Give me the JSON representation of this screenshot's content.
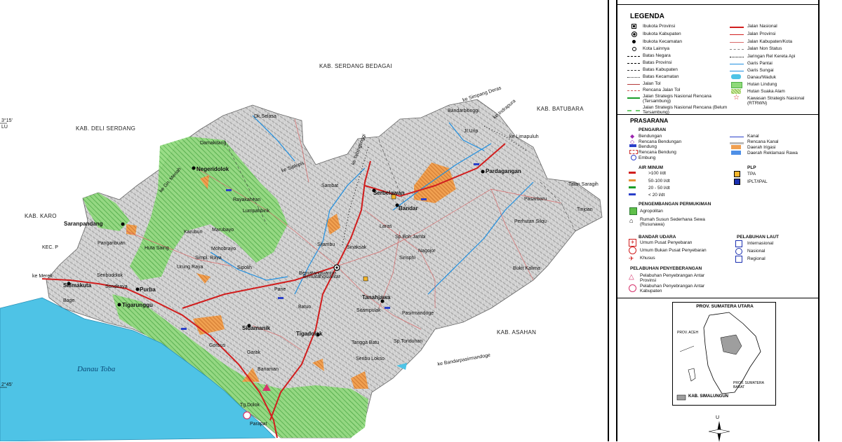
{
  "map": {
    "regions": {
      "deli_serdang": "KAB. DELI SERDANG",
      "serdang_bedagai": "KAB. SERDANG BEDAGAI",
      "batubara": "KAB. BATUBARA",
      "karo": "KAB. KARO",
      "asahan": "KAB. ASAHAN",
      "kec_karo": "KEC. P",
      "danau_toba": "Danau Toba"
    },
    "coords": {
      "lat_top": "3°15'",
      "lat_top_unit": "LU",
      "lat_bottom": "2°45'"
    },
    "towns": [
      "Dk.Selasa",
      "Damakitang",
      "Negeridolok",
      "Rayakahean",
      "Lumpahbirik",
      "Saranpandang",
      "Pangaribuan",
      "Huta Saing",
      "Karubun",
      "Marubayo",
      "Mohobrayo",
      "Simpl. Raya",
      "Urung Raya",
      "Sipolih",
      "Seribudolok",
      "Silimakuta",
      "Sondiraya",
      "Purba",
      "Tigarunggu",
      "Bage",
      "Sidamanik",
      "Gorbus",
      "Garak",
      "Banaman",
      "Tg.Dolok",
      "Parapat",
      "Tigadolok",
      "Batuo",
      "Bematangsiantar",
      "Pane",
      "Sitampulak",
      "Tanahjawa",
      "Pasirmandoge",
      "Tangga Batu",
      "Sp.Tonduhan",
      "Seribu Lokso",
      "Sijambu",
      "Sinaksak",
      "Laras",
      "Sp.Boh Jambi",
      "Sinsphi",
      "Nagojor",
      "Serbelawan",
      "Bandar",
      "Sambat",
      "Bandarbitinggi",
      "Jt.Urip",
      "Pardagangan",
      "Pasarbaru",
      "Perhutan Silqu",
      "Bukit Kalima",
      "Talan Saragih",
      "Tinjoan"
    ],
    "road_labels": {
      "to_merak": "ke Merek",
      "to_simpang_deras": "ke Simpang Deras",
      "to_indrapura": "ke Indrapura",
      "to_limapuluh": "ke Limapuluh",
      "to_tebingtinggi": "ke Tebingtinggi",
      "to_siplepis": "ke Siplepis",
      "to_gn_meriah": "ke Gn. Meriah",
      "to_bandarpasirmandoge": "ke Bandarpasirmandoge"
    }
  },
  "legend": {
    "title": "LEGENDA",
    "col1": [
      "Ibukota Provinsi",
      "Ibukota Kabupaten",
      "Ibukota Kecamatan",
      "Kota Lainnya",
      "Batas Negara",
      "Batas Provinsi",
      "Batas Kabupaten",
      "Batas Kecamatan",
      "Jalan Tol",
      "Rencana Jalan Tol",
      "Jalan Strategis Nasional Rencana (Tersambung)",
      "Jalan Strategis Nasional Rencana (Belum Tersambung)"
    ],
    "col2": [
      "Jalan Nasional",
      "Jalan Provinsi",
      "Jalan Kabupaten/Kota",
      "Jalan Non Status",
      "Jaringan Rel Kereta Api",
      "Garis Pantai",
      "Garis Sungai",
      "Danau/Waduk",
      "Hutan Lindung",
      "Hutan Suaka Alam",
      "Kawasan Strategis Nasional (RTRWN)"
    ],
    "prasarana_title": "PRASARANA",
    "pengairan_title": "PENGAIRAN",
    "pengairan": [
      "Bendungan",
      "Rencana Bendungan",
      "Bendung",
      "Rencana Bendung",
      "Embung"
    ],
    "pengairan_right": [
      "Kanal",
      "Rencana Kanal",
      "Daerah Irigasi",
      "Daerah Reklamasi Rawa"
    ],
    "air_minum_title": "AIR MINUM",
    "air_minum": [
      ">100 l/dt",
      "50-100 l/dt",
      "20 - 50 l/dt",
      "< 20 l/dt"
    ],
    "plp_title": "PLP",
    "plp": [
      "TPA",
      "IPLT/IPAL"
    ],
    "permukiman_title": "PENGEMBANGAN PERMUKIMAN",
    "permukiman": [
      "Agropolitan",
      "Rumah Susun Sederhana Sewa (Rusunawa)"
    ],
    "bandara_title": "BANDAR UDARA",
    "bandara": [
      "Umum Pusat Penyebaran",
      "Umum Bukan Pusat Penyebaran",
      "Khusus"
    ],
    "pelabuhan_laut_title": "PELABUHAN LAUT",
    "pelabuhan_laut": [
      "Internasional",
      "Nasional",
      "Regional"
    ],
    "penyeberangan_title": "PELABUHAN PENYEBERANGAN",
    "penyeberangan": [
      "Pelabuhan Penyebrangan Antar Provinsi",
      "Pelabuhan Penyebrangan Antar Kabupaten"
    ]
  },
  "inset": {
    "title": "PROV. SUMATERA UTARA",
    "prov_aceh": "PROV. ACEH",
    "sumbar": "PROV. SUMATERA BARAT",
    "key_label": "KAB. SIMALUNGUN"
  },
  "north_arrow": "U",
  "colors": {
    "relief": "#c9c9c9",
    "forest": "#7fd16a",
    "lake": "#4ec3e6",
    "river": "#1f8fe0",
    "road_national": "#d11e1e",
    "irrigation": "#e9923a"
  }
}
